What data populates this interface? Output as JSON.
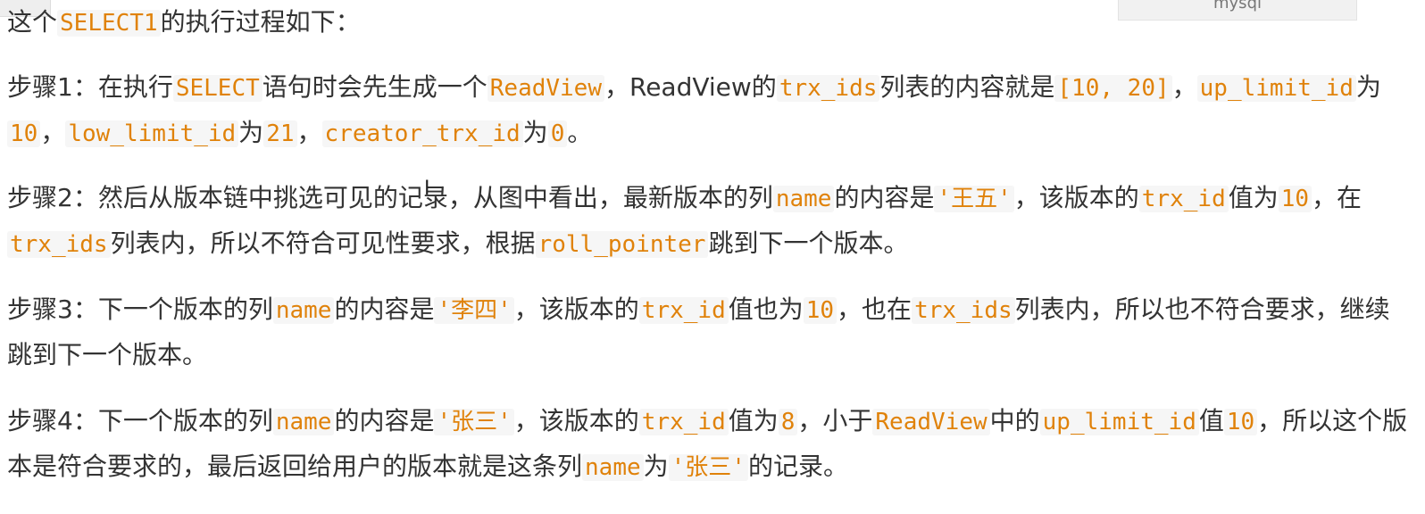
{
  "tab_label": "mysql",
  "cursor_glyph": "I",
  "paragraphs": [
    {
      "name": "intro",
      "segments": [
        {
          "t": "这个"
        },
        {
          "t": "SELECT1",
          "code": true
        },
        {
          "t": "的执行过程如下："
        }
      ]
    },
    {
      "name": "step-1",
      "segments": [
        {
          "t": "步骤1：在执行"
        },
        {
          "t": "SELECT",
          "code": true
        },
        {
          "t": "语句时会先生成一个"
        },
        {
          "t": "ReadView",
          "code": true
        },
        {
          "t": "，ReadView的"
        },
        {
          "t": "trx_ids",
          "code": true
        },
        {
          "t": "列表的内容就是"
        },
        {
          "t": "[10, 20]",
          "code": true
        },
        {
          "t": "，"
        },
        {
          "t": "up_limit_id",
          "code": true
        },
        {
          "t": "为"
        },
        {
          "t": "10",
          "code": true
        },
        {
          "t": "，"
        },
        {
          "t": "low_limit_id",
          "code": true
        },
        {
          "t": "为"
        },
        {
          "t": "21",
          "code": true
        },
        {
          "t": "，"
        },
        {
          "t": "creator_trx_id",
          "code": true
        },
        {
          "t": "为"
        },
        {
          "t": "0",
          "code": true
        },
        {
          "t": "。"
        }
      ]
    },
    {
      "name": "step-2",
      "segments": [
        {
          "t": "步骤2：然后从版本链中挑选可见的记录，从图中看出，最新版本的列"
        },
        {
          "t": "name",
          "code": true
        },
        {
          "t": "的内容是"
        },
        {
          "t": "'王五'",
          "code": true
        },
        {
          "t": "，该版本的"
        },
        {
          "t": "trx_id",
          "code": true
        },
        {
          "t": "值为"
        },
        {
          "t": "10",
          "code": true
        },
        {
          "t": "，在"
        },
        {
          "t": "trx_ids",
          "code": true
        },
        {
          "t": "列表内，所以不符合可见性要求，根据"
        },
        {
          "t": "roll_pointer",
          "code": true
        },
        {
          "t": "跳到下一个版本。"
        }
      ]
    },
    {
      "name": "step-3",
      "segments": [
        {
          "t": "步骤3：下一个版本的列"
        },
        {
          "t": "name",
          "code": true
        },
        {
          "t": "的内容是"
        },
        {
          "t": "'李四'",
          "code": true
        },
        {
          "t": "，该版本的"
        },
        {
          "t": "trx_id",
          "code": true
        },
        {
          "t": "值也为"
        },
        {
          "t": "10",
          "code": true
        },
        {
          "t": "，也在"
        },
        {
          "t": "trx_ids",
          "code": true
        },
        {
          "t": "列表内，所以也不符合要求，继续跳到下一个版本。"
        }
      ]
    },
    {
      "name": "step-4",
      "segments": [
        {
          "t": "步骤4：下一个版本的列"
        },
        {
          "t": "name",
          "code": true
        },
        {
          "t": "的内容是"
        },
        {
          "t": "'张三'",
          "code": true
        },
        {
          "t": "，该版本的"
        },
        {
          "t": "trx_id",
          "code": true
        },
        {
          "t": "值为"
        },
        {
          "t": "8",
          "code": true
        },
        {
          "t": "，小于"
        },
        {
          "t": "ReadView",
          "code": true
        },
        {
          "t": "中的"
        },
        {
          "t": "up_limit_id",
          "code": true
        },
        {
          "t": "值"
        },
        {
          "t": "10",
          "code": true
        },
        {
          "t": "，所以这个版本是符合要求的，最后返回给用户的版本就是这条列"
        },
        {
          "t": "name",
          "code": true
        },
        {
          "t": "为"
        },
        {
          "t": "'张三'",
          "code": true
        },
        {
          "t": "的记录。"
        }
      ]
    }
  ]
}
